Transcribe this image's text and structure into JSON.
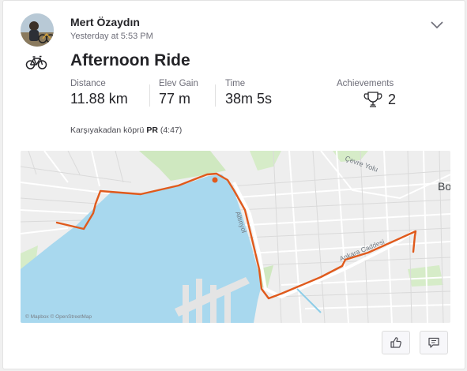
{
  "athlete": {
    "name": "Mert Özaydın",
    "timestamp": "Yesterday at 5:53 PM"
  },
  "activity": {
    "type_icon": "bicycle-icon",
    "title": "Afternoon Ride",
    "stats": [
      {
        "label": "Distance",
        "value": "11.88 km"
      },
      {
        "label": "Elev Gain",
        "value": "77 m"
      },
      {
        "label": "Time",
        "value": "38m 5s"
      }
    ],
    "achievements": {
      "label": "Achievements",
      "count": "2",
      "icon": "trophy-icon"
    },
    "segment": {
      "name": "Karşıyakadan köprü",
      "badge": "PR",
      "time": "(4:47)"
    }
  },
  "map": {
    "street_labels": [
      "Çevre Yolu",
      "Altınyol",
      "Ankara Caddesi"
    ],
    "place_label": "Bo",
    "attribution": "© Mapbox © OpenStreetMap",
    "route_color": "#e05a1c",
    "water_color": "#a8d8ee"
  },
  "actions": {
    "kudos_icon": "thumbs-up-icon",
    "comment_icon": "comment-icon"
  }
}
